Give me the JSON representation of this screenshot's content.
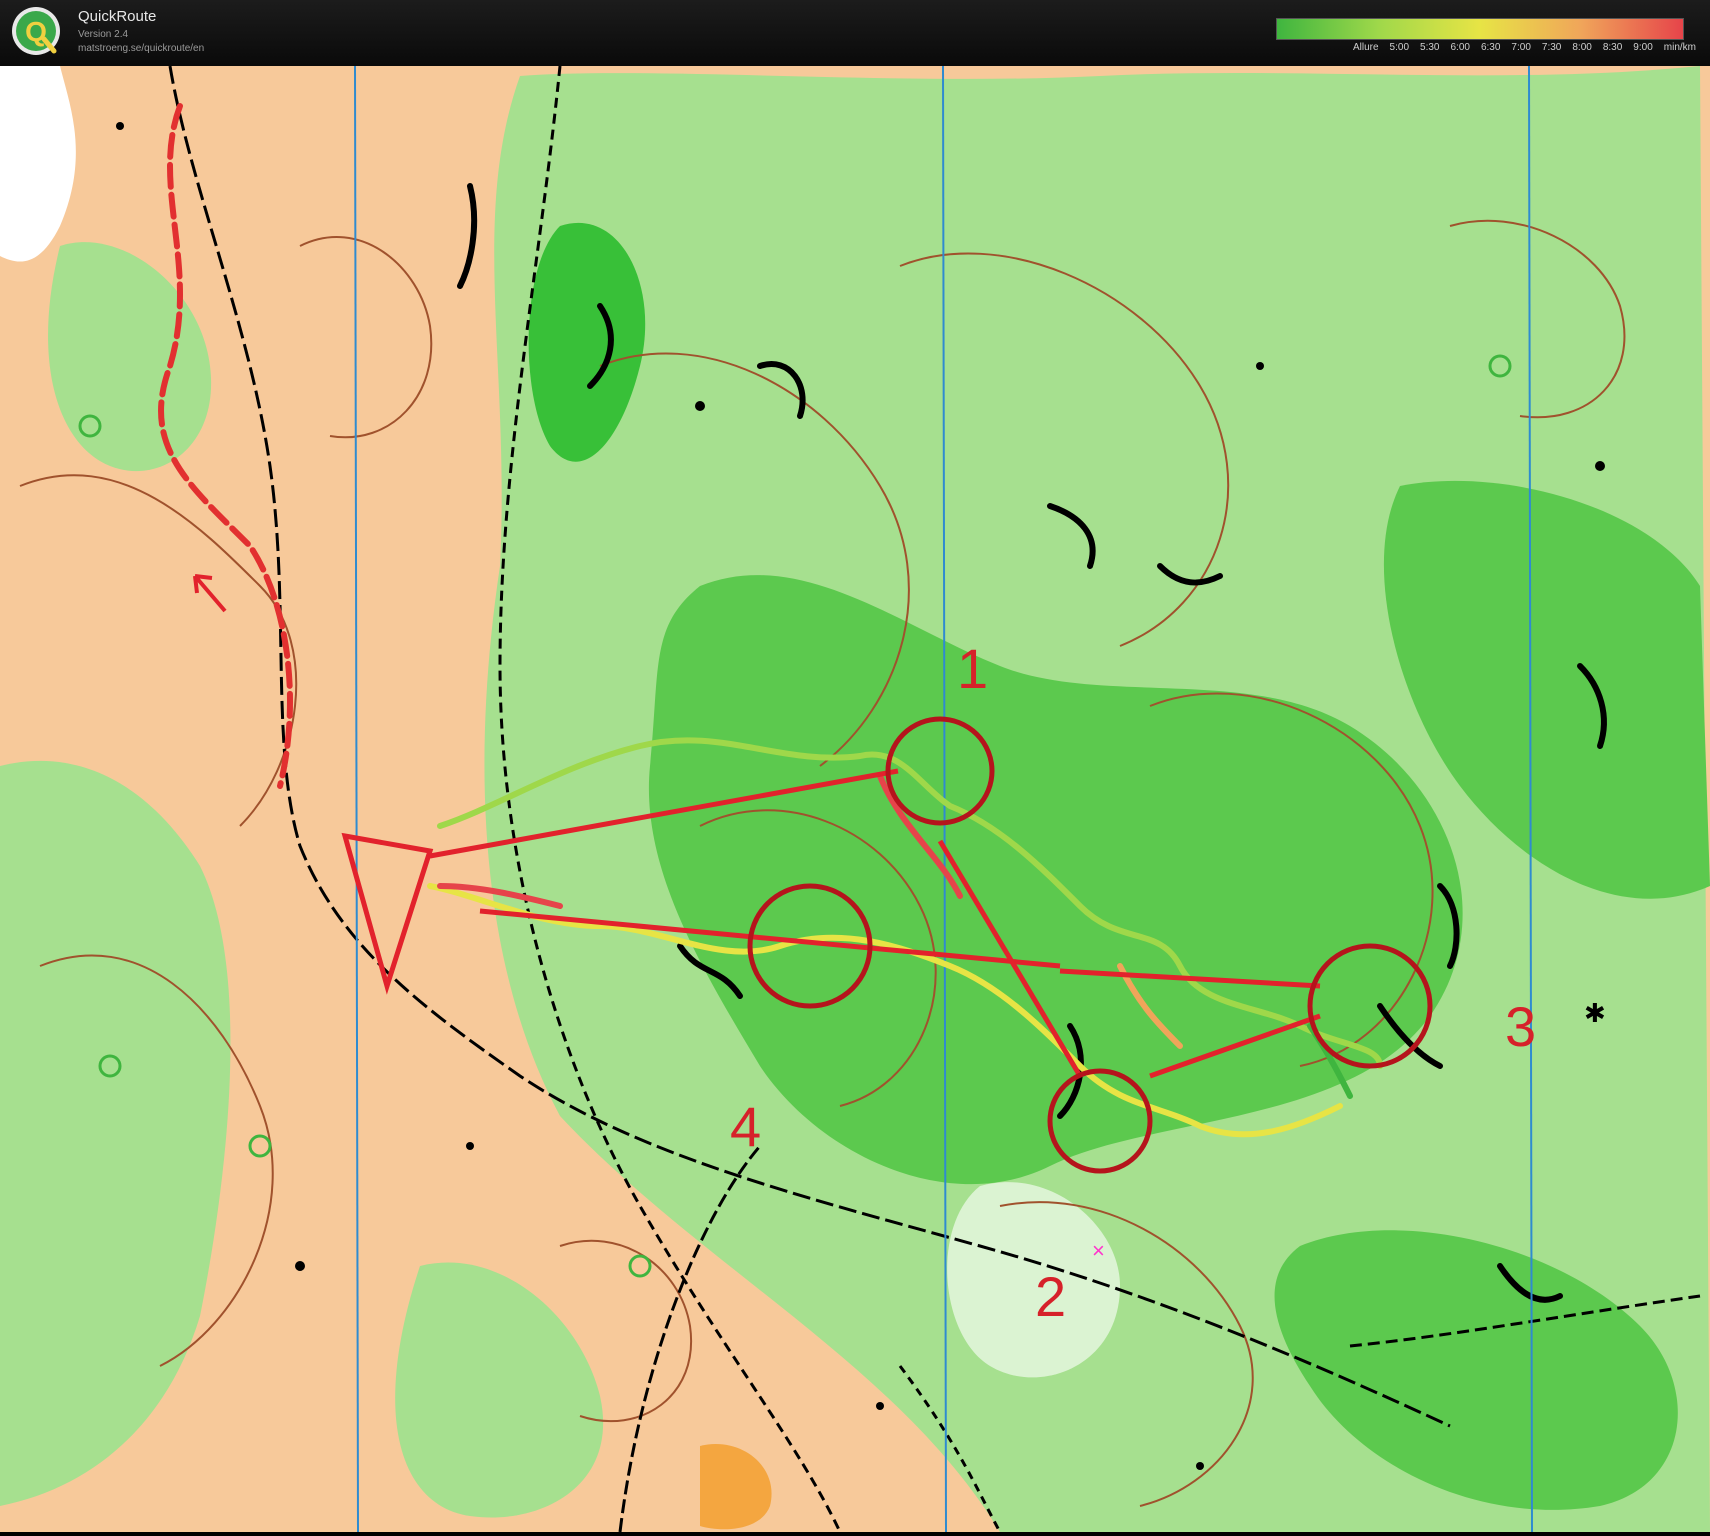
{
  "header": {
    "app_name": "QuickRoute",
    "version": "Version 2.4",
    "url": "matstroeng.se/quickroute/en",
    "logo_letter": "Q"
  },
  "legend": {
    "prefix": "Allure",
    "ticks": [
      "5:00",
      "5:30",
      "6:00",
      "6:30",
      "7:00",
      "7:30",
      "8:00",
      "8:30",
      "9:00"
    ],
    "unit": "min/km",
    "colors": [
      "#3fb53f",
      "#9fd84a",
      "#e7e445",
      "#f0a55a",
      "#e6444a"
    ]
  },
  "map": {
    "controls": [
      "1",
      "2",
      "3",
      "4"
    ],
    "colors": {
      "open_land": "#f7c99a",
      "forest_white": "#ffffff",
      "green_light": "#9be08e",
      "green_dark": "#38c038",
      "contour": "#a0522d",
      "course": "#e2222c",
      "magnetic_north": "#2f8bd0"
    }
  }
}
